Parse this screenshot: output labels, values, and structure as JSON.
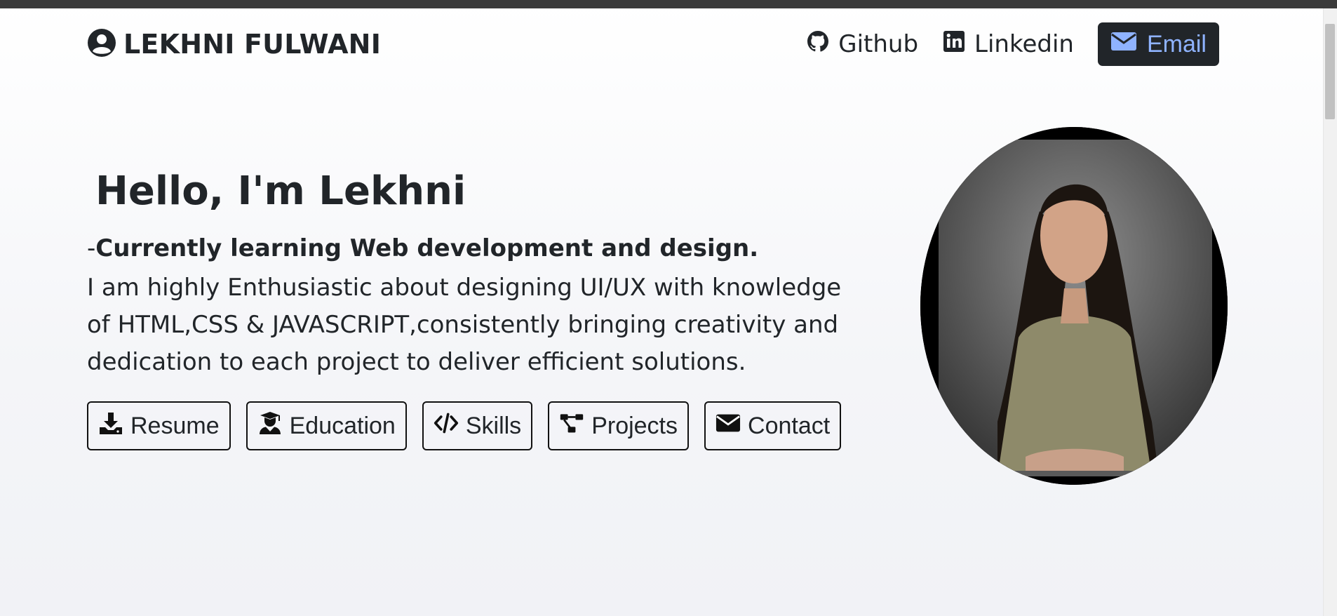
{
  "header": {
    "brand_icon": "user-circle-icon",
    "brand_name": "LEKHNI FULWANI",
    "nav": {
      "github": {
        "icon": "github-icon",
        "label": "Github"
      },
      "linkedin": {
        "icon": "linkedin-icon",
        "label": "Linkedin"
      },
      "email": {
        "icon": "envelope-icon",
        "label": "Email"
      }
    }
  },
  "hero": {
    "title": "Hello, I'm Lekhni",
    "subtitle_prefix": "-",
    "subtitle": "Currently learning Web development and design.",
    "description": "I am highly Enthusiastic about designing UI/UX with knowledge of HTML,CSS & JAVASCRIPT,consistently bringing creativity and dedication to each project to deliver efficient solutions.",
    "buttons": [
      {
        "icon": "download-icon",
        "label": "Resume"
      },
      {
        "icon": "graduate-icon",
        "label": "Education"
      },
      {
        "icon": "code-icon",
        "label": "Skills"
      },
      {
        "icon": "project-diagram-icon",
        "label": "Projects"
      },
      {
        "icon": "envelope-icon",
        "label": "Contact"
      }
    ],
    "photo": "profile-photo"
  },
  "colors": {
    "dark": "#212529",
    "email_accent": "#8fb3ff",
    "top_bar": "#3b3b3b"
  }
}
